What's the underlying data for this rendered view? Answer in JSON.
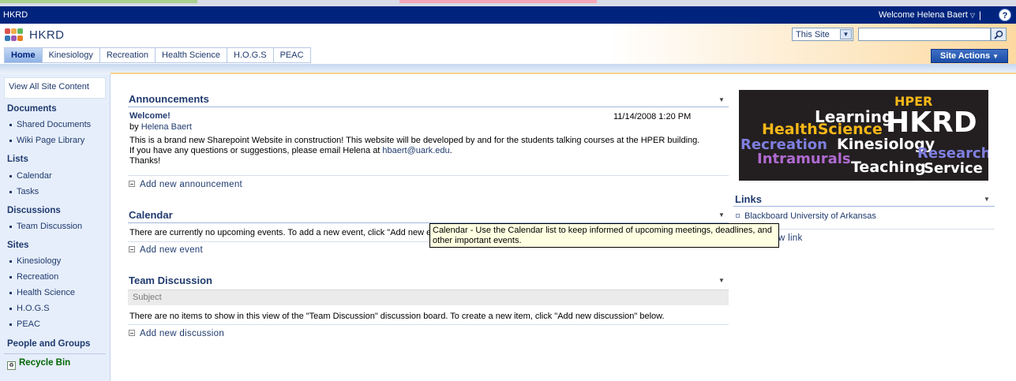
{
  "global": {
    "site_crumb": "HKRD",
    "welcome": "Welcome Helena Baert",
    "separator": "|",
    "help": "?"
  },
  "header": {
    "site_title": "HKRD",
    "search_scope": "This Site",
    "search_value": "",
    "search_icon": "magnifier-icon",
    "site_actions": "Site Actions"
  },
  "topnav": {
    "tabs": [
      "Home",
      "Kinesiology",
      "Recreation",
      "Health Science",
      "H.O.G.S",
      "PEAC"
    ]
  },
  "leftnav": {
    "view_all": "View All Site Content",
    "documents": {
      "heading": "Documents",
      "items": [
        "Shared Documents",
        "Wiki Page Library"
      ]
    },
    "lists": {
      "heading": "Lists",
      "items": [
        "Calendar",
        "Tasks"
      ]
    },
    "discussions": {
      "heading": "Discussions",
      "items": [
        "Team Discussion"
      ]
    },
    "sites": {
      "heading": "Sites",
      "items": [
        "Kinesiology",
        "Recreation",
        "Health Science",
        "H.O.G.S",
        "PEAC"
      ]
    },
    "people": "People and Groups",
    "recycle_bin": "Recycle Bin"
  },
  "announcements": {
    "title": "Announcements",
    "item_title": "Welcome!",
    "date": "11/14/2008 1:20 PM",
    "by_label": "by",
    "author": "Helena Baert",
    "body_line1": "This is a brand new Sharepoint Website in construction! This website will be developed by and for the students talking courses at the HPER building.",
    "body_line2_prefix": "If you have any questions or suggestions, please email Helena at ",
    "email": "hbaert@uark.edu",
    "body_line2_suffix": ".",
    "body_line3": "Thanks!",
    "add_new": "Add new announcement"
  },
  "calendar": {
    "title": "Calendar",
    "message": "There are currently no upcoming events. To add a new event, click \"Add new e",
    "add_new": "Add new event"
  },
  "discussion": {
    "title": "Team Discussion",
    "column": "Subject",
    "message": "There are no items to show in this view of the \"Team Discussion\" discussion board. To create a new item, click \"Add new discussion\" below.",
    "add_new": "Add new discussion"
  },
  "banner": {
    "words": [
      "HPER",
      "Learning",
      "HKRD",
      "HealthScience",
      "Recreation",
      "Kinesiology",
      "Research",
      "Intramurals",
      "Teaching",
      "Service"
    ]
  },
  "links": {
    "title": "Links",
    "items": [
      "Blackboard University of Arkansas"
    ],
    "add_new_partial": "w link"
  },
  "tooltip": {
    "line1": "Calendar - Use the Calendar list to keep informed of upcoming meetings, deadlines, and",
    "line2": "other important events."
  },
  "colors": {
    "global_bar": "#00247d",
    "link": "#1f3a6e",
    "quicklaunch_bg": "#e6eefb",
    "recycle": "#006600",
    "tooltip_bg": "#ffffe1"
  }
}
